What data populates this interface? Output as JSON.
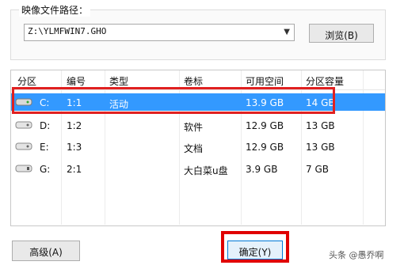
{
  "image_path": {
    "label": "映像文件路径：",
    "value": "Z:\\YLMFWIN7.GHO",
    "browse_label": "浏览(B)"
  },
  "table": {
    "headers": [
      "分区",
      "编号",
      "类型",
      "卷标",
      "可用空间",
      "分区容量"
    ],
    "rows": [
      {
        "drive": "C:",
        "num": "1:1",
        "type": "活动",
        "label": "",
        "free": "13.9 GB",
        "size": "14 GB",
        "selected": true
      },
      {
        "drive": "D:",
        "num": "1:2",
        "type": "",
        "label": "软件",
        "free": "12.9 GB",
        "size": "13 GB",
        "selected": false
      },
      {
        "drive": "E:",
        "num": "1:3",
        "type": "",
        "label": "文档",
        "free": "12.9 GB",
        "size": "13 GB",
        "selected": false
      },
      {
        "drive": "G:",
        "num": "2:1",
        "type": "",
        "label": "大白菜u盘",
        "free": "3.9 GB",
        "size": "7 GB",
        "selected": false
      }
    ]
  },
  "buttons": {
    "advanced": "高级(A)",
    "ok": "确定(Y)"
  },
  "watermark": "头条 @愚乔啊",
  "colors": {
    "selection": "#3399ff",
    "highlight": "#e02020"
  }
}
